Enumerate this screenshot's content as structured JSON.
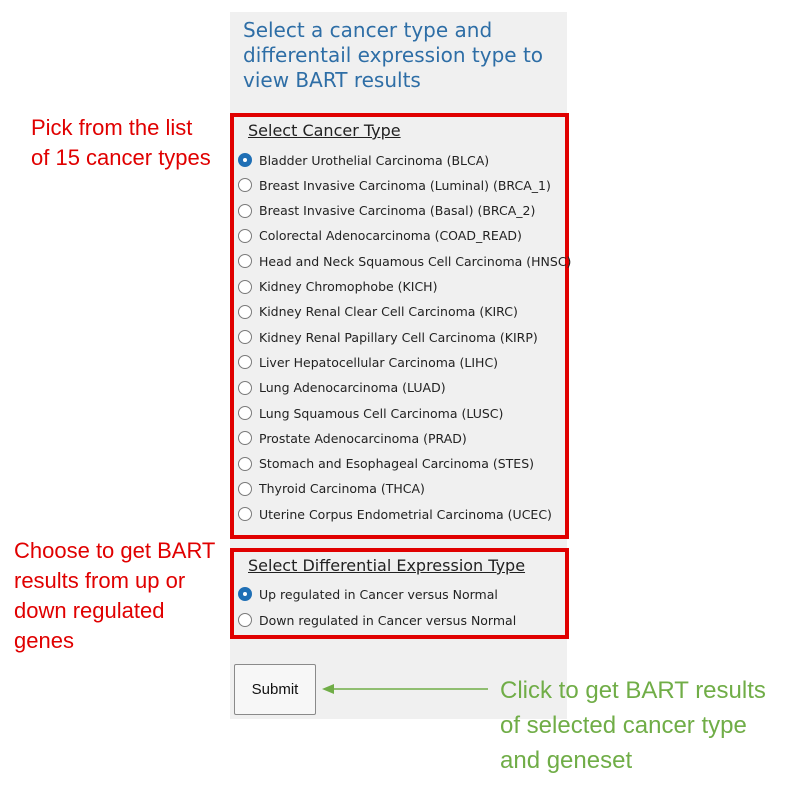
{
  "panel": {
    "title": "Select a cancer type and differentail expression type to view BART results"
  },
  "cancer_section": {
    "title": "Select Cancer Type",
    "options": [
      {
        "label": "Bladder Urothelial Carcinoma (BLCA)",
        "checked": true
      },
      {
        "label": "Breast Invasive Carcinoma (Luminal) (BRCA_1)",
        "checked": false
      },
      {
        "label": "Breast Invasive Carcinoma (Basal) (BRCA_2)",
        "checked": false
      },
      {
        "label": "Colorectal Adenocarcinoma (COAD_READ)",
        "checked": false
      },
      {
        "label": "Head and Neck Squamous Cell Carcinoma (HNSC)",
        "checked": false
      },
      {
        "label": "Kidney Chromophobe (KICH)",
        "checked": false
      },
      {
        "label": "Kidney Renal Clear Cell Carcinoma (KIRC)",
        "checked": false
      },
      {
        "label": "Kidney Renal Papillary Cell Carcinoma (KIRP)",
        "checked": false
      },
      {
        "label": "Liver Hepatocellular Carcinoma (LIHC)",
        "checked": false
      },
      {
        "label": "Lung Adenocarcinoma (LUAD)",
        "checked": false
      },
      {
        "label": "Lung Squamous Cell Carcinoma (LUSC)",
        "checked": false
      },
      {
        "label": "Prostate Adenocarcinoma (PRAD)",
        "checked": false
      },
      {
        "label": "Stomach and Esophageal Carcinoma (STES)",
        "checked": false
      },
      {
        "label": "Thyroid Carcinoma (THCA)",
        "checked": false
      },
      {
        "label": "Uterine Corpus Endometrial Carcinoma (UCEC)",
        "checked": false
      }
    ]
  },
  "diff_section": {
    "title": "Select Differential Expression Type",
    "options": [
      {
        "label": "Up regulated in Cancer versus Normal",
        "checked": true
      },
      {
        "label": "Down regulated in Cancer versus Normal",
        "checked": false
      }
    ]
  },
  "submit": {
    "label": "Submit"
  },
  "annotations": {
    "cancer_note_line1": "Pick from the list",
    "cancer_note_line2": "of 15 cancer types",
    "diff_note_line1": "Choose to get BART",
    "diff_note_line2": "results from up or",
    "diff_note_line3": "down regulated",
    "diff_note_line4": "genes",
    "submit_note_line1": "Click to get BART results",
    "submit_note_line2": "of selected cancer type",
    "submit_note_line3": "and geneset"
  },
  "colors": {
    "highlight_border": "#e00000",
    "annotation_red": "#e00000",
    "annotation_green": "#70ad47",
    "title_blue": "#2e6ea6",
    "radio_checked": "#1f6fb5",
    "panel_bg": "#f0f0f0"
  }
}
